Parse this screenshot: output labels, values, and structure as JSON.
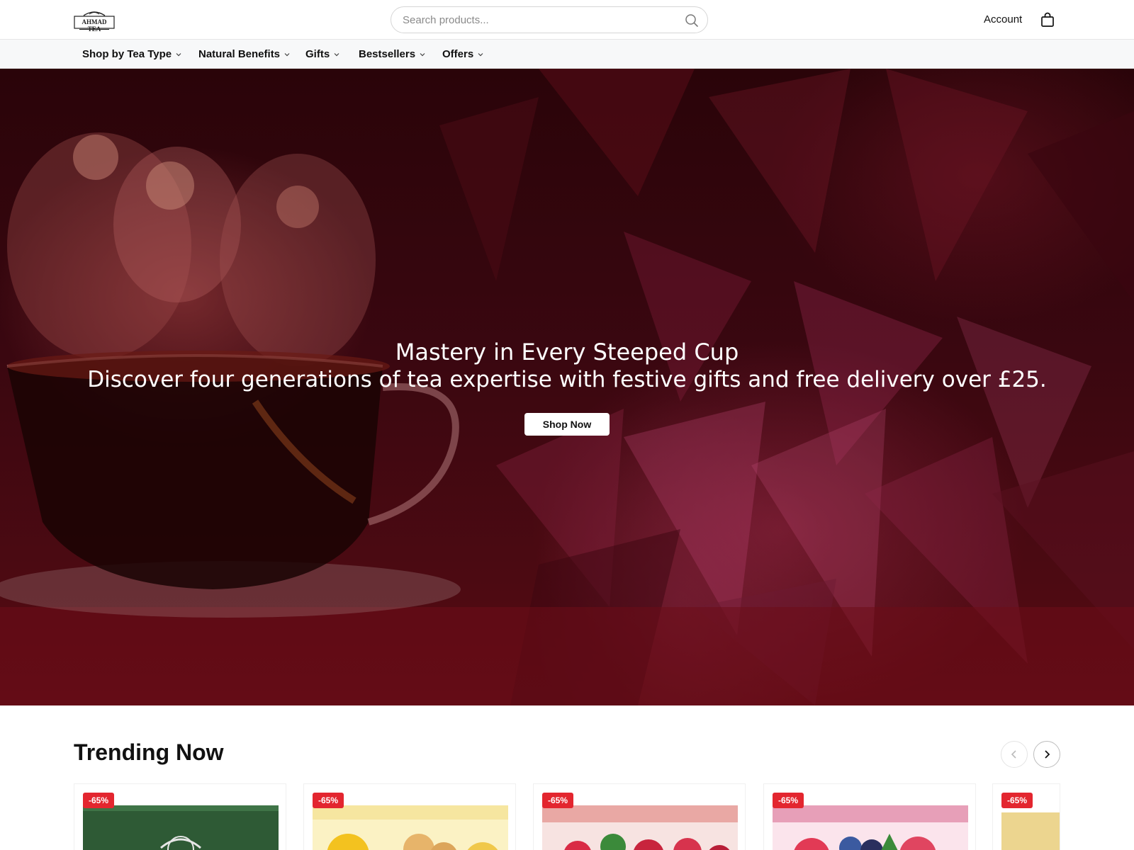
{
  "header": {
    "logo_text": "AHMAD TEA",
    "search_placeholder": "Search products...",
    "account_label": "Account"
  },
  "nav": {
    "items": [
      {
        "label": "Shop by Tea Type"
      },
      {
        "label": "Natural Benefits"
      },
      {
        "label": "Gifts"
      },
      {
        "label": "Bestsellers"
      },
      {
        "label": "Offers"
      }
    ]
  },
  "hero": {
    "title": "Mastery in Every Steeped Cup",
    "subtitle": "Discover four generations of tea expertise with festive gifts and free delivery over £25.",
    "cta_label": "Shop Now"
  },
  "trending": {
    "title": "Trending Now",
    "products": [
      {
        "discount": "-65%",
        "color": "#2e5a35"
      },
      {
        "discount": "-65%",
        "color": "#f3d25a"
      },
      {
        "discount": "-65%",
        "color": "#e9a8a4"
      },
      {
        "discount": "-65%",
        "color": "#e79fb8"
      },
      {
        "discount": "-65%",
        "color": "#ecd58f"
      }
    ]
  },
  "colors": {
    "badge": "#e3262f",
    "hero_base": "#3a0710"
  }
}
